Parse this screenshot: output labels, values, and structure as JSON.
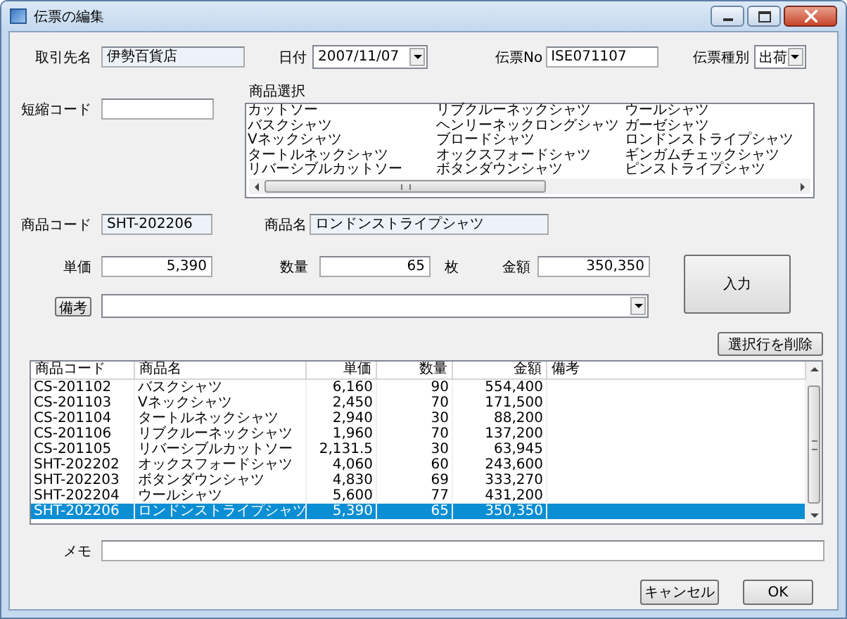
{
  "window": {
    "title": "伝票の編集"
  },
  "customer": {
    "label": "取引先名",
    "value": "伊勢百貨店",
    "readonly": true
  },
  "date": {
    "label": "日付",
    "value": "2007/11/07"
  },
  "slip_no": {
    "label": "伝票No",
    "value": "ISE071107",
    "readonly": false
  },
  "slip_type": {
    "label": "伝票種別",
    "value": "出荷"
  },
  "short_code": {
    "label": "短縮コード",
    "readonly": false
  },
  "product_select": {
    "label": "商品選択",
    "items": [
      "カットソー",
      "バスクシャツ",
      "Vネックシャツ",
      "タートルネックシャツ",
      "リバーシブルカットソー",
      "リブクルーネックシャツ",
      "ヘンリーネックロングシャツ",
      "ブロードシャツ",
      "オックスフォードシャツ",
      "ボタンダウンシャツ",
      "ウールシャツ",
      "ガーゼシャツ",
      "ロンドンストライプシャツ",
      "ギンガムチェックシャツ",
      "ピンストライプシャツ"
    ]
  },
  "product_code": {
    "label": "商品コード",
    "value": "SHT-202206",
    "readonly": true
  },
  "product_name": {
    "label": "商品名",
    "value": "ロンドンストライプシャツ",
    "readonly": true
  },
  "unit_price": {
    "label": "単価",
    "value": "5,390",
    "readonly": false
  },
  "quantity": {
    "label": "数量",
    "value": "65",
    "unit": "枚",
    "readonly": false
  },
  "amount": {
    "label": "金額",
    "value": "350,350",
    "readonly": false
  },
  "remarks": {
    "button": "備考"
  },
  "enter_button": "入力",
  "delete_button": "選択行を削除",
  "table": {
    "columns": [
      "商品コード",
      "商品名",
      "単価",
      "数量",
      "金額",
      "備考"
    ],
    "rows": [
      {
        "cells": [
          "CS-201102",
          "バスクシャツ",
          "6,160",
          "90",
          "554,400"
        ],
        "selected": false
      },
      {
        "cells": [
          "CS-201103",
          "Vネックシャツ",
          "2,450",
          "70",
          "171,500"
        ],
        "selected": false
      },
      {
        "cells": [
          "CS-201104",
          "タートルネックシャツ",
          "2,940",
          "30",
          "88,200"
        ],
        "selected": false
      },
      {
        "cells": [
          "CS-201106",
          "リブクルーネックシャツ",
          "1,960",
          "70",
          "137,200"
        ],
        "selected": false
      },
      {
        "cells": [
          "CS-201105",
          "リバーシブルカットソー",
          "2,131.5",
          "30",
          "63,945"
        ],
        "selected": false
      },
      {
        "cells": [
          "SHT-202202",
          "オックスフォードシャツ",
          "4,060",
          "60",
          "243,600"
        ],
        "selected": false
      },
      {
        "cells": [
          "SHT-202203",
          "ボタンダウンシャツ",
          "4,830",
          "69",
          "333,270"
        ],
        "selected": false
      },
      {
        "cells": [
          "SHT-202204",
          "ウールシャツ",
          "5,600",
          "77",
          "431,200"
        ],
        "selected": false
      },
      {
        "cells": [
          "SHT-202206",
          "ロンドンストライプシャツ",
          "5,390",
          "65",
          "350,350"
        ],
        "selected": true
      }
    ]
  },
  "memo": {
    "label": "メモ"
  },
  "buttons": [
    "キャンセル",
    "OK"
  ]
}
